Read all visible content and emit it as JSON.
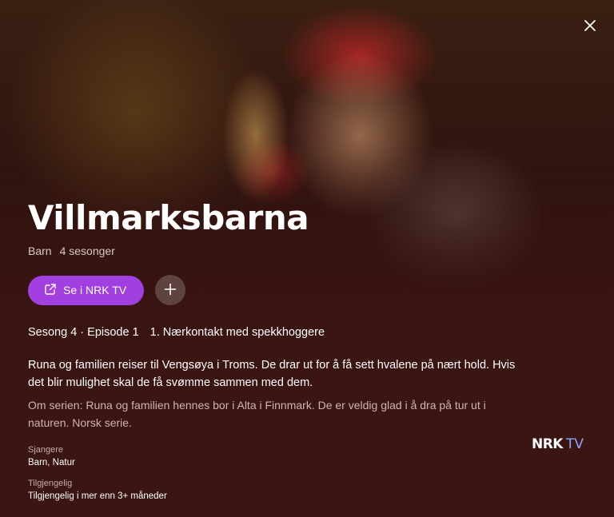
{
  "close_label": "×",
  "title": "Villmarksbarna",
  "meta": {
    "genre": "Barn",
    "seasons": "4 sesonger"
  },
  "actions": {
    "watch_label": "Se i NRK TV",
    "watch_icon": "external-link-icon",
    "add_icon": "plus-icon"
  },
  "episode": {
    "number": "Sesong 4 · Episode 1",
    "title": "1. Nærkontakt med spekkhoggere"
  },
  "description": "Runa og familien reiser til Vengsøya i Troms. De drar ut for å få sett hvalene på nært hold. Hvis det blir mulighet skal de få svømme sammen med dem.",
  "series_info": "Om serien: Runa og familien hennes bor i Alta i Finnmark. De er veldig glad i å dra på tur ut i naturen. Norsk serie.",
  "details": {
    "genres_label": "Sjangere",
    "genres_value": "Barn, Natur",
    "availability_label": "Tilgjengelig",
    "availability_value": "Tilgjengelig i mer enn 3+ måneder"
  },
  "logo": {
    "brand": "NRK",
    "suffix": "TV"
  },
  "colors": {
    "accent": "#a13fe0",
    "background": "#3a1512",
    "logo_tv": "#8ea5ff"
  }
}
